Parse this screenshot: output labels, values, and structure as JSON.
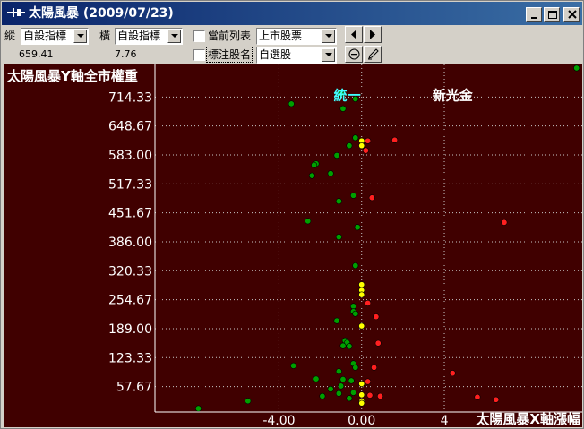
{
  "window": {
    "title": "太陽風暴 (2009/07/23)"
  },
  "toolbar": {
    "vertical_label": "縱",
    "vertical_value": "自設指標",
    "horizontal_label": "橫",
    "horizontal_value": "自設指標",
    "current_list_label": "當前列表",
    "current_list_value": "上市股票",
    "mark_name_label": "標注股名",
    "mark_name_value": "自選股",
    "vertical_readout": "659.41",
    "horizontal_readout": "7.76"
  },
  "colors": {
    "plot_bg": "#400000",
    "green_dot": "#00a000",
    "red_dot": "#ff2020",
    "yellow_dot": "#ffff00",
    "title_bar": "#0a246a"
  },
  "icons": [
    "app-icon",
    "minimize-icon",
    "maximize-icon",
    "close-icon",
    "triangle-left-icon",
    "triangle-right-icon",
    "minus-circle-icon",
    "pen-icon",
    "chevron-down-icon"
  ],
  "chart_data": {
    "type": "scatter",
    "ylabel": "太陽風暴Y軸全市權重",
    "xlabel": "太陽風暴X軸漲幅",
    "y_ticks": [
      "714.33",
      "648.67",
      "583.00",
      "517.33",
      "451.67",
      "386.00",
      "320.33",
      "254.67",
      "189.00",
      "123.33",
      "57.67"
    ],
    "x_ticks": [
      "-4.00",
      "0.00",
      "4"
    ],
    "ylim": [
      0,
      780
    ],
    "xlim": [
      -10,
      10.5
    ],
    "grid": true,
    "annotations": [
      {
        "text": "統一",
        "x": -0.7,
        "y": 722,
        "color": "#40ffff"
      },
      {
        "text": "新光金",
        "x": 4.4,
        "y": 722,
        "color": "#ffffff"
      }
    ],
    "series": [
      {
        "color": "green",
        "points": [
          [
            10.4,
            780
          ],
          [
            -1.0,
            722
          ],
          [
            -0.3,
            710
          ],
          [
            -3.4,
            699
          ],
          [
            -0.9,
            688
          ],
          [
            -0.3,
            622
          ],
          [
            -0.6,
            604
          ],
          [
            -1.2,
            582
          ],
          [
            -2.2,
            563
          ],
          [
            -2.3,
            560
          ],
          [
            -1.5,
            541
          ],
          [
            -2.4,
            536
          ],
          [
            -0.4,
            491
          ],
          [
            -1.1,
            478
          ],
          [
            -2.6,
            433
          ],
          [
            -0.2,
            419
          ],
          [
            -1.1,
            397
          ],
          [
            -0.3,
            332
          ],
          [
            -0.4,
            240
          ],
          [
            -0.4,
            228
          ],
          [
            -0.3,
            223
          ],
          [
            -1.2,
            207
          ],
          [
            -0.8,
            162
          ],
          [
            -0.7,
            157
          ],
          [
            -0.9,
            150
          ],
          [
            -0.6,
            149
          ],
          [
            -0.4,
            110
          ],
          [
            -0.3,
            101
          ],
          [
            -1.1,
            92
          ],
          [
            -3.3,
            105
          ],
          [
            -2.2,
            75
          ],
          [
            -0.9,
            74
          ],
          [
            -0.5,
            71
          ],
          [
            -1.0,
            59
          ],
          [
            -1.5,
            52
          ],
          [
            -0.4,
            44
          ],
          [
            -1.9,
            36
          ],
          [
            -5.5,
            25
          ],
          [
            -7.9,
            8
          ],
          [
            -1.1,
            42
          ],
          [
            -0.6,
            31
          ]
        ]
      },
      {
        "color": "red",
        "points": [
          [
            0.3,
            615
          ],
          [
            1.6,
            617
          ],
          [
            0.2,
            593
          ],
          [
            0.5,
            486
          ],
          [
            6.9,
            430
          ],
          [
            0.3,
            247
          ],
          [
            0.7,
            216
          ],
          [
            0.8,
            156
          ],
          [
            0.6,
            101
          ],
          [
            4.4,
            88
          ],
          [
            0.3,
            69
          ],
          [
            0.9,
            36
          ],
          [
            5.6,
            34
          ],
          [
            6.5,
            28
          ],
          [
            0.4,
            38
          ]
        ]
      },
      {
        "color": "yellow",
        "points": [
          [
            0.0,
            615
          ],
          [
            0.0,
            604
          ],
          [
            0.0,
            289
          ],
          [
            0.0,
            276
          ],
          [
            0.0,
            266
          ],
          [
            0.0,
            195
          ],
          [
            0.0,
            64
          ],
          [
            0.0,
            39
          ],
          [
            0.0,
            24
          ],
          [
            0.0,
            20
          ]
        ]
      }
    ]
  }
}
